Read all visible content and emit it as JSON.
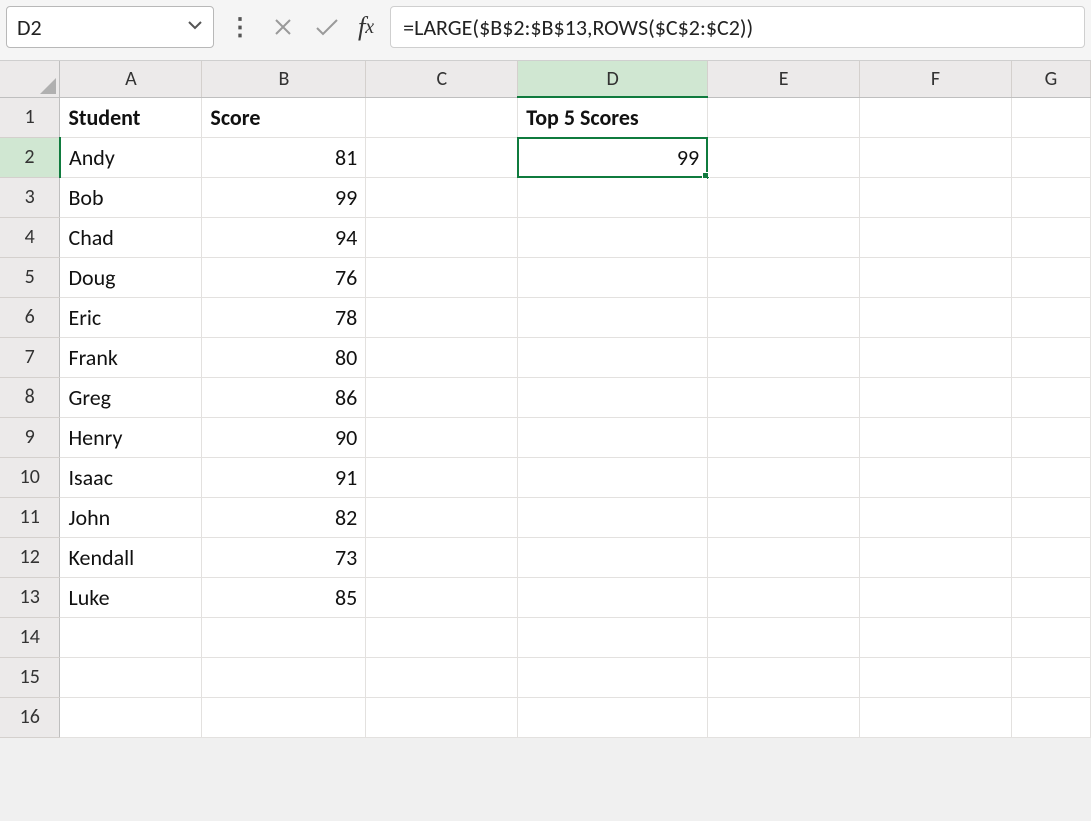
{
  "namebox": {
    "value": "D2"
  },
  "formula_bar": {
    "value": "=LARGE($B$2:$B$13,ROWS($C$2:$C2))"
  },
  "columns": [
    "A",
    "B",
    "C",
    "D",
    "E",
    "F",
    "G"
  ],
  "row_numbers": [
    "1",
    "2",
    "3",
    "4",
    "5",
    "6",
    "7",
    "8",
    "9",
    "10",
    "11",
    "12",
    "13",
    "14",
    "15",
    "16"
  ],
  "selected_col_index": 3,
  "selected_row_index": 1,
  "grid": {
    "r1": {
      "A": "Student",
      "B": "Score",
      "D": "Top 5 Scores"
    },
    "r2": {
      "A": "Andy",
      "B": "81",
      "D": "99"
    },
    "r3": {
      "A": "Bob",
      "B": "99"
    },
    "r4": {
      "A": "Chad",
      "B": "94"
    },
    "r5": {
      "A": "Doug",
      "B": "76"
    },
    "r6": {
      "A": "Eric",
      "B": "78"
    },
    "r7": {
      "A": "Frank",
      "B": "80"
    },
    "r8": {
      "A": "Greg",
      "B": "86"
    },
    "r9": {
      "A": "Henry",
      "B": "90"
    },
    "r10": {
      "A": "Isaac",
      "B": "91"
    },
    "r11": {
      "A": "John",
      "B": "82"
    },
    "r12": {
      "A": "Kendall",
      "B": "73"
    },
    "r13": {
      "A": "Luke",
      "B": "85"
    }
  }
}
